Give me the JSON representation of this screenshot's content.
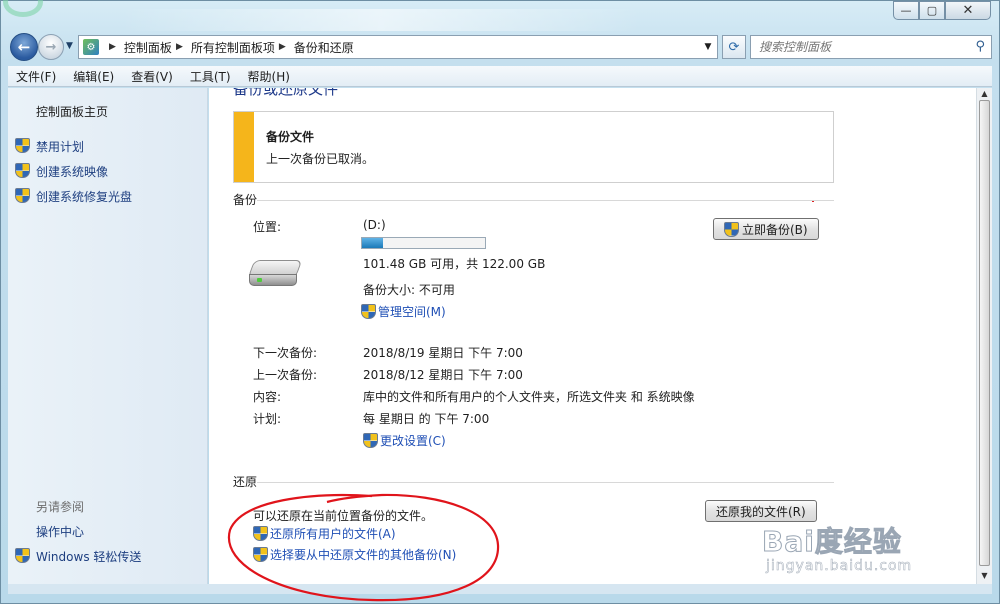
{
  "window": {
    "min_glyph": "—",
    "max_glyph": "▢",
    "close_glyph": "✕"
  },
  "nav": {
    "back_glyph": "←",
    "forward_glyph": "→",
    "history_glyph": "▼",
    "breadcrumbs": [
      "控制面板",
      "所有控制面板项",
      "备份和还原"
    ],
    "crumb_sep": "▶",
    "dropdown_glyph": "▼",
    "refresh_glyph": "⟳",
    "search_placeholder": "搜索控制面板",
    "search_glyph": "⚲"
  },
  "menu": [
    "文件(F)",
    "编辑(E)",
    "查看(V)",
    "工具(T)",
    "帮助(H)"
  ],
  "sidebar": {
    "home": "控制面板主页",
    "tasks": [
      "禁用计划",
      "创建系统映像",
      "创建系统修复光盘"
    ],
    "see_also_heading": "另请参阅",
    "see_also": [
      "操作中心",
      "Windows 轻松传送"
    ]
  },
  "main": {
    "page_title_cut": "备份或还原文件",
    "notice": {
      "title": "备份文件",
      "text": "上一次备份已取消。"
    },
    "backup": {
      "heading": "备份",
      "location_label": "位置:",
      "location_value": "(D:)",
      "disk_used_fraction": 0.17,
      "space_text": "101.48 GB 可用，共 122.00 GB",
      "size_text": "备份大小: 不可用",
      "manage_space": "管理空间(M)",
      "backup_now": "立即备份(B)",
      "next_label": "下一次备份:",
      "next_value": "2018/8/19 星期日 下午 7:00",
      "last_label": "上一次备份:",
      "last_value": "2018/8/12 星期日 下午 7:00",
      "content_label": "内容:",
      "content_value": "库中的文件和所有用户的个人文件夹，所选文件夹 和 系统映像",
      "schedule_label": "计划:",
      "schedule_value": "每 星期日 的 下午 7:00",
      "change_settings": "更改设置(C)"
    },
    "restore": {
      "heading": "还原",
      "text": "可以还原在当前位置备份的文件。",
      "restore_my_files": "还原我的文件(R)",
      "restore_all_users": "还原所有用户的文件(A)",
      "select_other": "选择要从中还原文件的其他备份(N)"
    }
  },
  "scrollbar": {
    "up_glyph": "▲",
    "down_glyph": "▼"
  },
  "watermark": {
    "brand": "Bai度经验",
    "url": "jingyan.baidu.com"
  },
  "colors": {
    "link": "#1f4fb5",
    "accent_bar": "#f5b51b",
    "annotation": "#e0141b"
  }
}
